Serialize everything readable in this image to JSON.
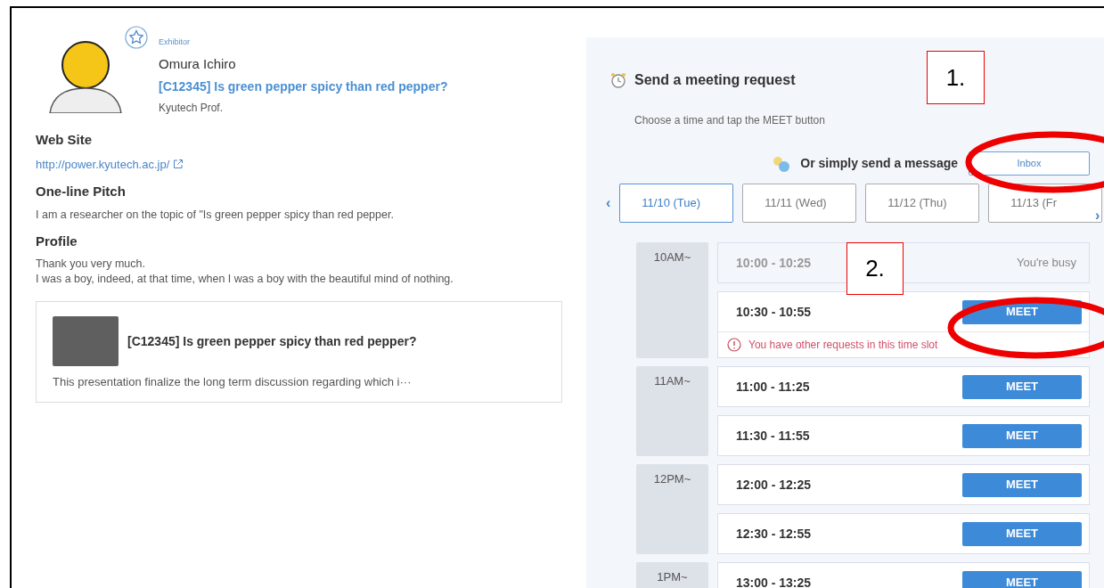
{
  "profile": {
    "badge": "Exhibitor",
    "name": "Omura Ichiro",
    "presentation_link": "[C12345] Is green pepper spicy than red pepper?",
    "affiliation": "Kyutech Prof."
  },
  "sections": [
    {
      "heading": "Web Site",
      "kind": "link",
      "lines": [
        "http://power.kyutech.ac.jp/"
      ]
    },
    {
      "heading": "One-line Pitch",
      "kind": "text",
      "lines": [
        "I am a researcher on the topic of \"Is green pepper spicy than red pepper."
      ]
    },
    {
      "heading": "Profile",
      "kind": "text",
      "lines": [
        "Thank you very much.",
        "I was a boy, indeed, at that time, when I was a boy with the beautiful mind of nothing."
      ]
    }
  ],
  "presentation_card": {
    "title": "[C12345] Is green pepper spicy than red pepper?",
    "summary": "This presentation finalize the long term discussion regarding which i···"
  },
  "meeting": {
    "previous_arrow": "‹",
    "next_arrow": "›",
    "title": "Send a meeting request",
    "instruction": "Choose a time and tap the MEET button",
    "message_prompt": "Or simply send a message",
    "inbox_button": "Inbox",
    "dates": [
      {
        "label": "11/10 (Tue)",
        "selected": true
      },
      {
        "label": "11/11 (Wed)",
        "selected": false
      },
      {
        "label": "11/12 (Thu)",
        "selected": false
      },
      {
        "label": "11/13 (Fr",
        "selected": false
      }
    ],
    "hours": [
      {
        "label": "10AM~",
        "slots": [
          {
            "time": "10:00 - 10:25",
            "kind": "busy",
            "status": "You're busy"
          },
          {
            "time": "10:30 - 10:55",
            "kind": "open",
            "button": "MEET",
            "warning": "You have other requests in this time slot"
          }
        ]
      },
      {
        "label": "11AM~",
        "slots": [
          {
            "time": "11:00 - 11:25",
            "kind": "open",
            "button": "MEET"
          },
          {
            "time": "11:30 - 11:55",
            "kind": "open",
            "button": "MEET"
          }
        ]
      },
      {
        "label": "12PM~",
        "slots": [
          {
            "time": "12:00 - 12:25",
            "kind": "open",
            "button": "MEET"
          },
          {
            "time": "12:30 - 12:55",
            "kind": "open",
            "button": "MEET"
          }
        ]
      },
      {
        "label": "1PM~",
        "slots": [
          {
            "time": "13:00 - 13:25",
            "kind": "open",
            "button": "MEET"
          }
        ]
      }
    ]
  },
  "annotations": [
    {
      "kind": "numbered-box",
      "text": "1."
    },
    {
      "kind": "ellipse"
    },
    {
      "kind": "numbered-box",
      "text": "2."
    },
    {
      "kind": "ellipse"
    }
  ]
}
